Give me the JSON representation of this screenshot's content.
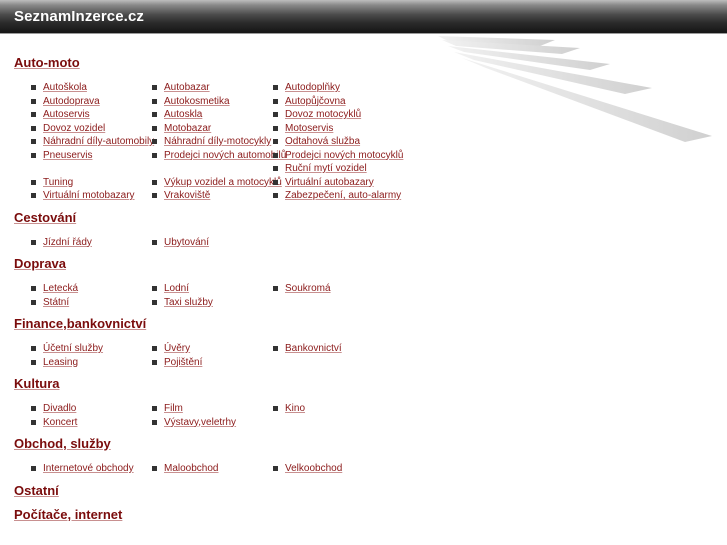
{
  "site": {
    "title": "SeznamInzerce.cz"
  },
  "categories": [
    {
      "title": "Auto-moto",
      "items": [
        "Autoškola",
        "Autobazar",
        "Autodoplňky",
        "Autodoprava",
        "Autokosmetika",
        "Autopůjčovna",
        "Autoservis",
        "Autoskla",
        "Dovoz motocyklů",
        "Dovoz vozidel",
        "Motobazar",
        "Motoservis",
        "Náhradní díly-automobily",
        "Náhradní díly-motocykly",
        "Odtahová služba",
        "Pneuservis",
        "Prodejci nových automobilů",
        "Prodejci nových motocyklů",
        "",
        "",
        "Ruční mytí vozidel",
        "Tuning",
        "Výkup vozidel a motocyklů",
        "Virtuální autobazary",
        "Virtuální motobazary",
        "Vrakoviště",
        "Zabezpečení, auto-alarmy"
      ]
    },
    {
      "title": "Cestování",
      "items": [
        "Jízdní řády",
        "Ubytování"
      ]
    },
    {
      "title": "Doprava",
      "items": [
        "Letecká",
        "Lodní",
        "Soukromá",
        "Státní",
        "Taxi služby"
      ]
    },
    {
      "title": "Finance,bankovnictví",
      "items": [
        "Účetní služby",
        "Úvěry",
        "Bankovnictví",
        "Leasing",
        "Pojištění"
      ]
    },
    {
      "title": "Kultura",
      "items": [
        "Divadlo",
        "Film",
        "Kino",
        "Koncert",
        "Výstavy,veletrhy"
      ]
    },
    {
      "title": "Obchod, služby",
      "items": [
        "Internetové obchody",
        "Maloobchod",
        "Velkoobchod"
      ]
    },
    {
      "title": "Ostatní",
      "items": []
    },
    {
      "title": "Počítače, internet",
      "items": []
    }
  ],
  "colors": {
    "heading": "#7a0c0c",
    "link": "#8b1a1a",
    "header_bg": "#2a2a2a"
  }
}
